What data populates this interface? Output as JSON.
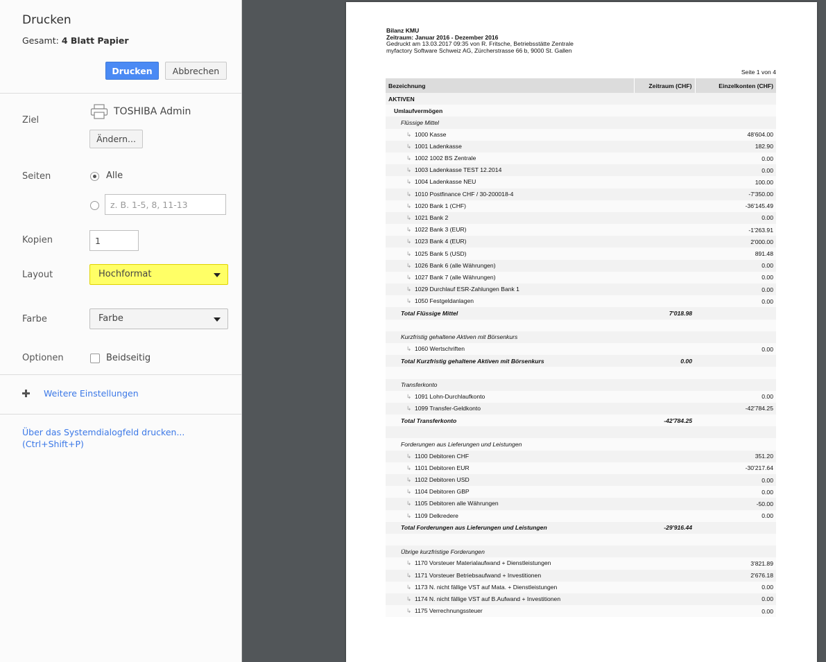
{
  "header": {
    "title": "Drucken",
    "summary_prefix": "Gesamt:",
    "summary_value": "4 Blatt Papier",
    "print_label": "Drucken",
    "cancel_label": "Abbrechen"
  },
  "settings": {
    "destination": {
      "label": "Ziel",
      "printer": "TOSHIBA Admin",
      "change_label": "Ändern..."
    },
    "pages": {
      "label": "Seiten",
      "all_label": "Alle",
      "range_placeholder": "z. B. 1-5, 8, 11-13"
    },
    "copies": {
      "label": "Kopien",
      "value": "1"
    },
    "layout": {
      "label": "Layout",
      "value": "Hochformat"
    },
    "color": {
      "label": "Farbe",
      "value": "Farbe"
    },
    "options": {
      "label": "Optionen",
      "duplex_label": "Beidseitig"
    },
    "more_settings": "Weitere Einstellungen",
    "system_dialog_line1": "Über das Systemdialogfeld drucken...",
    "system_dialog_line2": "(Ctrl+Shift+P)"
  },
  "preview": {
    "title": "Bilanz KMU",
    "period": "Zeitraum: Januar 2016 - Dezember 2016",
    "printed": "Gedruckt am 13.03.2017 09:35 von R. Fritsche, Betriebsstätte Zentrale",
    "company": "myfactory Software Schweiz AG, Zürcherstrasse 66 b, 9000 St. Gallen",
    "page_indicator": "Seite 1 von 4",
    "columns": [
      "Bezeichnung",
      "Zeitraum (CHF)",
      "Einzelkonten (CHF)"
    ],
    "rows": [
      {
        "type": "sec",
        "label": "AKTIVEN",
        "z": "",
        "e": ""
      },
      {
        "type": "sub",
        "label": "Umlaufvermögen",
        "z": "",
        "e": ""
      },
      {
        "type": "grp",
        "label": "Flüssige Mittel",
        "z": "",
        "e": ""
      },
      {
        "type": "acc",
        "label": "1000 Kasse",
        "z": "",
        "e": "48'604.00"
      },
      {
        "type": "acc",
        "label": "1001 Ladenkasse",
        "z": "",
        "e": "182.90"
      },
      {
        "type": "acc",
        "label": "1002 1002 BS Zentrale",
        "z": "",
        "e": "0.00"
      },
      {
        "type": "acc",
        "label": "1003 Ladenkasse TEST 12.2014",
        "z": "",
        "e": "0.00"
      },
      {
        "type": "acc",
        "label": "1004 Ladenkasse NEU",
        "z": "",
        "e": "100.00"
      },
      {
        "type": "acc",
        "label": "1010 Postfinance CHF / 30-200018-4",
        "z": "",
        "e": "-7'350.00"
      },
      {
        "type": "acc",
        "label": "1020 Bank 1 (CHF)",
        "z": "",
        "e": "-36'145.49"
      },
      {
        "type": "acc",
        "label": "1021 Bank 2",
        "z": "",
        "e": "0.00"
      },
      {
        "type": "acc",
        "label": "1022 Bank 3 (EUR)",
        "z": "",
        "e": "-1'263.91"
      },
      {
        "type": "acc",
        "label": "1023 Bank 4 (EUR)",
        "z": "",
        "e": "2'000.00"
      },
      {
        "type": "acc",
        "label": "1025 Bank 5 (USD)",
        "z": "",
        "e": "891.48"
      },
      {
        "type": "acc",
        "label": "1026 Bank 6 (alle Währungen)",
        "z": "",
        "e": "0.00"
      },
      {
        "type": "acc",
        "label": "1027 Bank 7 (alle Währungen)",
        "z": "",
        "e": "0.00"
      },
      {
        "type": "acc",
        "label": "1029 Durchlauf ESR-Zahlungen Bank 1",
        "z": "",
        "e": "0.00"
      },
      {
        "type": "acc",
        "label": "1050 Festgeldanlagen",
        "z": "",
        "e": "0.00"
      },
      {
        "type": "tot",
        "label": "Total Flüssige Mittel",
        "z": "7'018.98",
        "e": ""
      },
      {
        "type": "blank",
        "label": "",
        "z": "",
        "e": ""
      },
      {
        "type": "grp",
        "label": "Kurzfristig gehaltene Aktiven mit Börsenkurs",
        "z": "",
        "e": ""
      },
      {
        "type": "acc",
        "label": "1060 Wertschriften",
        "z": "",
        "e": "0.00"
      },
      {
        "type": "tot",
        "label": "Total Kurzfristig gehaltene Aktiven mit Börsenkurs",
        "z": "0.00",
        "e": ""
      },
      {
        "type": "blank",
        "label": "",
        "z": "",
        "e": ""
      },
      {
        "type": "grp",
        "label": "Transferkonto",
        "z": "",
        "e": ""
      },
      {
        "type": "acc",
        "label": "1091 Lohn-Durchlaufkonto",
        "z": "",
        "e": "0.00"
      },
      {
        "type": "acc",
        "label": "1099 Transfer-Geldkonto",
        "z": "",
        "e": "-42'784.25"
      },
      {
        "type": "tot",
        "label": "Total Transferkonto",
        "z": "-42'784.25",
        "e": ""
      },
      {
        "type": "blank",
        "label": "",
        "z": "",
        "e": ""
      },
      {
        "type": "grp",
        "label": "Forderungen aus Lieferungen und Leistungen",
        "z": "",
        "e": ""
      },
      {
        "type": "acc",
        "label": "1100 Debitoren CHF",
        "z": "",
        "e": "351.20"
      },
      {
        "type": "acc",
        "label": "1101 Debitoren EUR",
        "z": "",
        "e": "-30'217.64"
      },
      {
        "type": "acc",
        "label": "1102 Debitoren USD",
        "z": "",
        "e": "0.00"
      },
      {
        "type": "acc",
        "label": "1104 Debitoren GBP",
        "z": "",
        "e": "0.00"
      },
      {
        "type": "acc",
        "label": "1105 Debitoren alle Währungen",
        "z": "",
        "e": "-50.00"
      },
      {
        "type": "acc",
        "label": "1109 Delkredere",
        "z": "",
        "e": "0.00"
      },
      {
        "type": "tot",
        "label": "Total Forderungen aus Lieferungen und Leistungen",
        "z": "-29'916.44",
        "e": ""
      },
      {
        "type": "blank",
        "label": "",
        "z": "",
        "e": ""
      },
      {
        "type": "grp",
        "label": "Übrige kurzfristige Forderungen",
        "z": "",
        "e": ""
      },
      {
        "type": "acc",
        "label": "1170 Vorsteuer Materialaufwand + Dienstleistungen",
        "z": "",
        "e": "3'821.89"
      },
      {
        "type": "acc",
        "label": "1171 Vorsteuer Betriebsaufwand + Investitionen",
        "z": "",
        "e": "2'676.18"
      },
      {
        "type": "acc",
        "label": "1173 N. nicht fällige VST auf Mata. + Dienstleistungen",
        "z": "",
        "e": "0.00"
      },
      {
        "type": "acc",
        "label": "1174 N. nicht fällige VST auf B.Aufwand + Investitionen",
        "z": "",
        "e": "0.00"
      },
      {
        "type": "acc",
        "label": "1175 Verrechnungssteuer",
        "z": "",
        "e": "0.00"
      }
    ]
  },
  "colors": {
    "accent": "#4a8af4",
    "link": "#3b78e7",
    "highlight": "#ffff66",
    "preview_bg": "#525659"
  },
  "icons": {
    "printer": "printer-icon",
    "plus": "plus-icon",
    "caret": "caret-down-icon"
  }
}
